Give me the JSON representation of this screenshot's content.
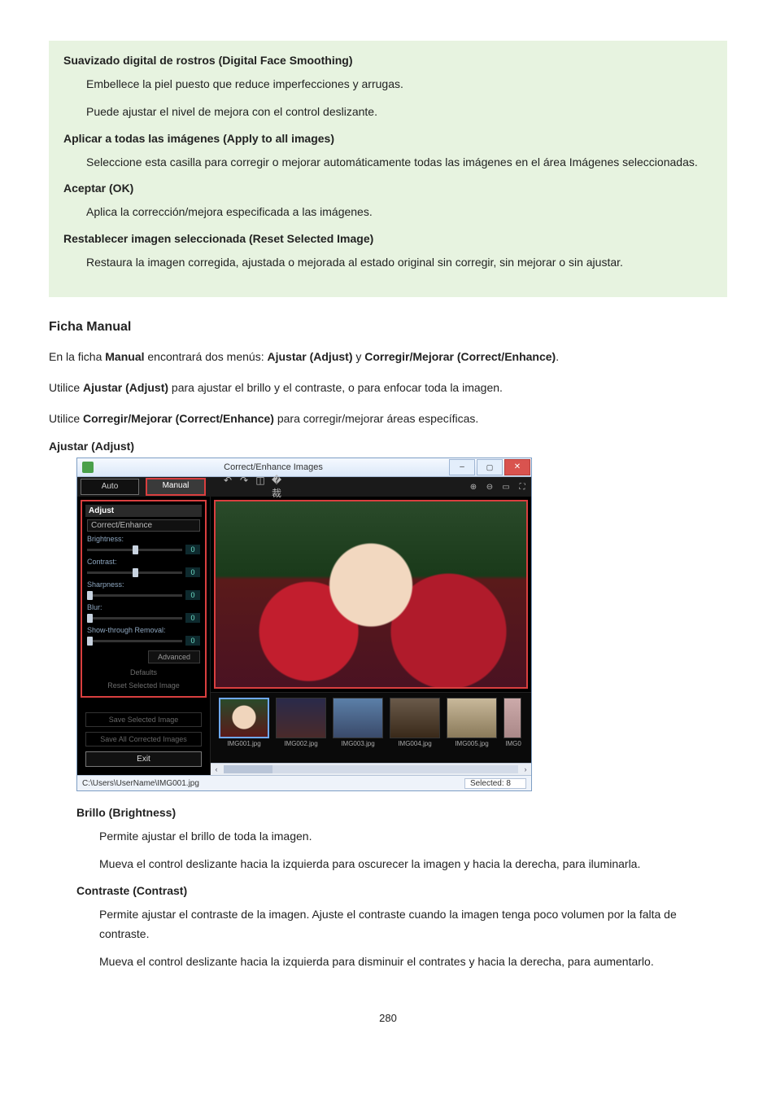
{
  "page_number": "280",
  "greenbox": {
    "items": [
      {
        "title": "Suavizado digital de rostros (Digital Face Smoothing)",
        "paras": [
          "Embellece la piel puesto que reduce imperfecciones y arrugas.",
          "Puede ajustar el nivel de mejora con el control deslizante."
        ]
      },
      {
        "title": "Aplicar a todas las imágenes (Apply to all images)",
        "paras": [
          "Seleccione esta casilla para corregir o mejorar automáticamente todas las imágenes en el área Imágenes seleccionadas."
        ]
      },
      {
        "title": "Aceptar (OK)",
        "paras": [
          "Aplica la corrección/mejora especificada a las imágenes."
        ]
      },
      {
        "title": "Restablecer imagen seleccionada (Reset Selected Image)",
        "paras": [
          "Restaura la imagen corregida, ajustada o mejorada al estado original sin corregir, sin mejorar o sin ajustar."
        ]
      }
    ]
  },
  "section": {
    "heading": "Ficha Manual",
    "intro_pre": "En la ficha ",
    "intro_b1": "Manual",
    "intro_mid1": " encontrará dos menús: ",
    "intro_b2": "Ajustar (Adjust)",
    "intro_mid2": " y ",
    "intro_b3": "Corregir/Mejorar (Correct/Enhance)",
    "intro_post": ".",
    "p2_pre": "Utilice ",
    "p2_b": "Ajustar (Adjust)",
    "p2_post": " para ajustar el brillo y el contraste, o para enfocar toda la imagen.",
    "p3_pre": "Utilice ",
    "p3_b": "Corregir/Mejorar (Correct/Enhance)",
    "p3_post": " para corregir/mejorar áreas específicas.",
    "sub_heading": "Ajustar (Adjust)"
  },
  "shot": {
    "title": "Correct/Enhance Images",
    "tabs": {
      "auto": "Auto",
      "manual": "Manual"
    },
    "panel": {
      "adjust": "Adjust",
      "correct": "Correct/Enhance",
      "brightness": "Brightness:",
      "contrast": "Contrast:",
      "sharpness": "Sharpness:",
      "blur": "Blur:",
      "showthrough": "Show-through Removal:",
      "value0": "0",
      "advanced": "Advanced",
      "defaults": "Defaults",
      "reset": "Reset Selected Image",
      "save_sel": "Save Selected Image",
      "save_all": "Save All Corrected Images",
      "exit": "Exit"
    },
    "thumbs": [
      "IMG001.jpg",
      "IMG002.jpg",
      "IMG003.jpg",
      "IMG004.jpg",
      "IMG005.jpg",
      "IMG0"
    ],
    "status_path": "C:\\Users\\UserName\\IMG001.jpg",
    "selected": "Selected: 8"
  },
  "defs": {
    "brightness": {
      "title": "Brillo (Brightness)",
      "paras": [
        "Permite ajustar el brillo de toda la imagen.",
        "Mueva el control deslizante hacia la izquierda para oscurecer la imagen y hacia la derecha, para iluminarla."
      ]
    },
    "contrast": {
      "title": "Contraste (Contrast)",
      "paras": [
        "Permite ajustar el contraste de la imagen. Ajuste el contraste cuando la imagen tenga poco volumen por la falta de contraste.",
        "Mueva el control deslizante hacia la izquierda para disminuir el contrates y hacia la derecha, para aumentarlo."
      ]
    }
  }
}
